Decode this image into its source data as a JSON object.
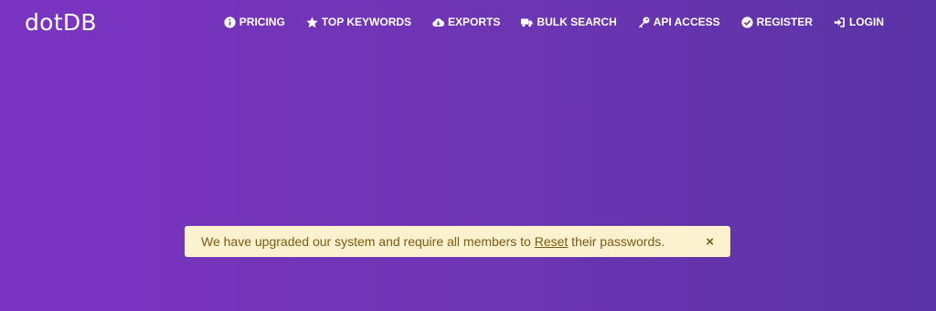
{
  "header": {
    "logo": "dotDB",
    "nav": [
      {
        "label": "PRICING",
        "icon": "info-circle-icon"
      },
      {
        "label": "TOP KEYWORDS",
        "icon": "star-icon"
      },
      {
        "label": "EXPORTS",
        "icon": "cloud-download-icon"
      },
      {
        "label": "BULK SEARCH",
        "icon": "truck-icon"
      },
      {
        "label": "API ACCESS",
        "icon": "key-icon"
      },
      {
        "label": "REGISTER",
        "icon": "check-circle-icon"
      },
      {
        "label": "LOGIN",
        "icon": "sign-in-icon"
      }
    ]
  },
  "notice": {
    "text_before": "We have upgraded our system and require all members to ",
    "link": "Reset",
    "text_after": " their passwords.",
    "close": "×"
  },
  "colors": {
    "background_start": "#7b34c2",
    "background_end": "#5a33a6",
    "notice_bg": "#fdf2cf",
    "notice_text": "#7a5a14"
  }
}
